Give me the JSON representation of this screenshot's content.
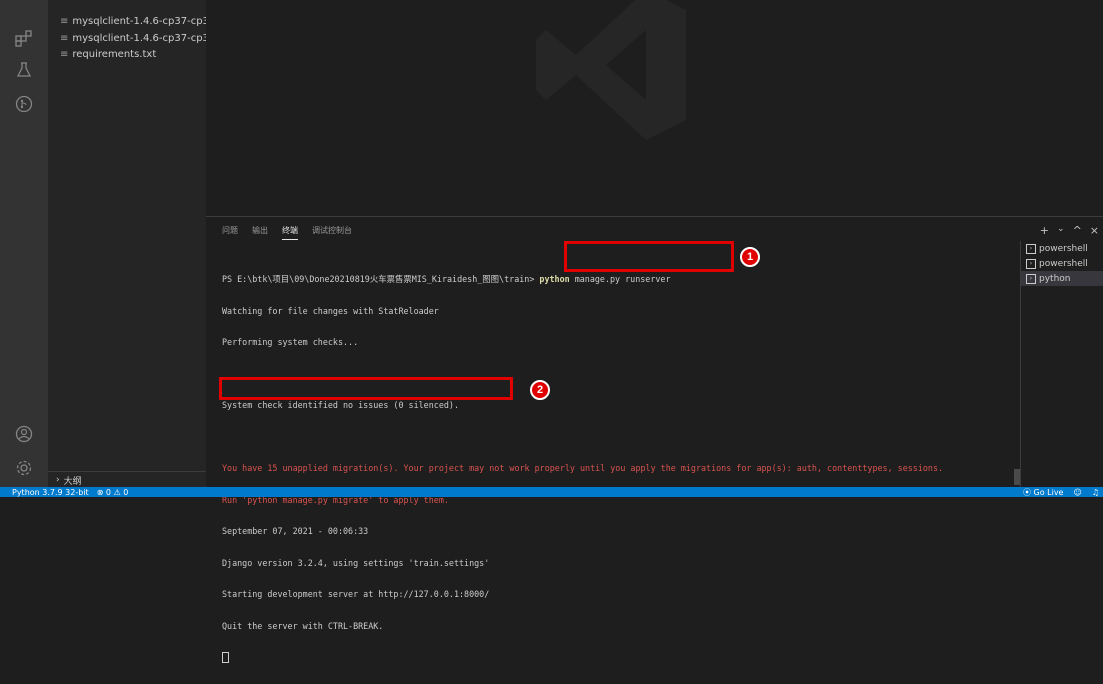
{
  "explorer": {
    "files": [
      {
        "name": "mysqlclient-1.4.6-cp37-cp37..."
      },
      {
        "name": "mysqlclient-1.4.6-cp37-cp37..."
      },
      {
        "name": "requirements.txt"
      }
    ],
    "outline_label": "大纲"
  },
  "activity_bar": {
    "icons": [
      "extensions-icon",
      "testing-icon",
      "source-control-icon",
      "account-icon",
      "settings-gear-icon"
    ]
  },
  "panel": {
    "tabs": [
      {
        "label": "问题"
      },
      {
        "label": "输出"
      },
      {
        "label": "终端",
        "active": true
      },
      {
        "label": "调试控制台"
      }
    ],
    "actions": [
      "+",
      "⌄",
      "^",
      "×"
    ],
    "terminal": {
      "prompt": "PS E:\\btk\\项目\\09\\Done20210819火车票售票MIS_Kiraidesh_图图\\train>",
      "command_python": "python",
      "command_rest": " manage.py runserver",
      "lines": [
        {
          "text": "Watching for file changes with StatReloader",
          "style": "normal"
        },
        {
          "text": "Performing system checks...",
          "style": "normal"
        },
        {
          "text": "",
          "style": "normal"
        },
        {
          "text": "System check identified no issues (0 silenced).",
          "style": "normal"
        },
        {
          "text": "",
          "style": "normal"
        },
        {
          "text": "You have 15 unapplied migration(s). Your project may not work properly until you apply the migrations for app(s): auth, contenttypes, sessions.",
          "style": "red"
        },
        {
          "text": "Run 'python manage.py migrate' to apply them.",
          "style": "red"
        },
        {
          "text": "September 07, 2021 - 00:06:33",
          "style": "normal"
        },
        {
          "text": "Django version 3.2.4, using settings 'train.settings'",
          "style": "normal"
        },
        {
          "text": "Starting development server at http://127.0.0.1:8000/",
          "style": "normal"
        },
        {
          "text": "Quit the server with CTRL-BREAK.",
          "style": "normal"
        }
      ]
    },
    "terminal_list": [
      {
        "label": "powershell"
      },
      {
        "label": "powershell"
      },
      {
        "label": "python",
        "active": true
      }
    ],
    "badges": [
      "1",
      "2"
    ]
  },
  "statusbar": {
    "python": "Python 3.7.9 32-bit",
    "problems": "⊗ 0 ⚠ 0",
    "go_live": "⦿ Go Live"
  },
  "colors": {
    "accent": "#007acc",
    "highlight_red": "#e00000",
    "terminal_error": "#d9534f"
  }
}
